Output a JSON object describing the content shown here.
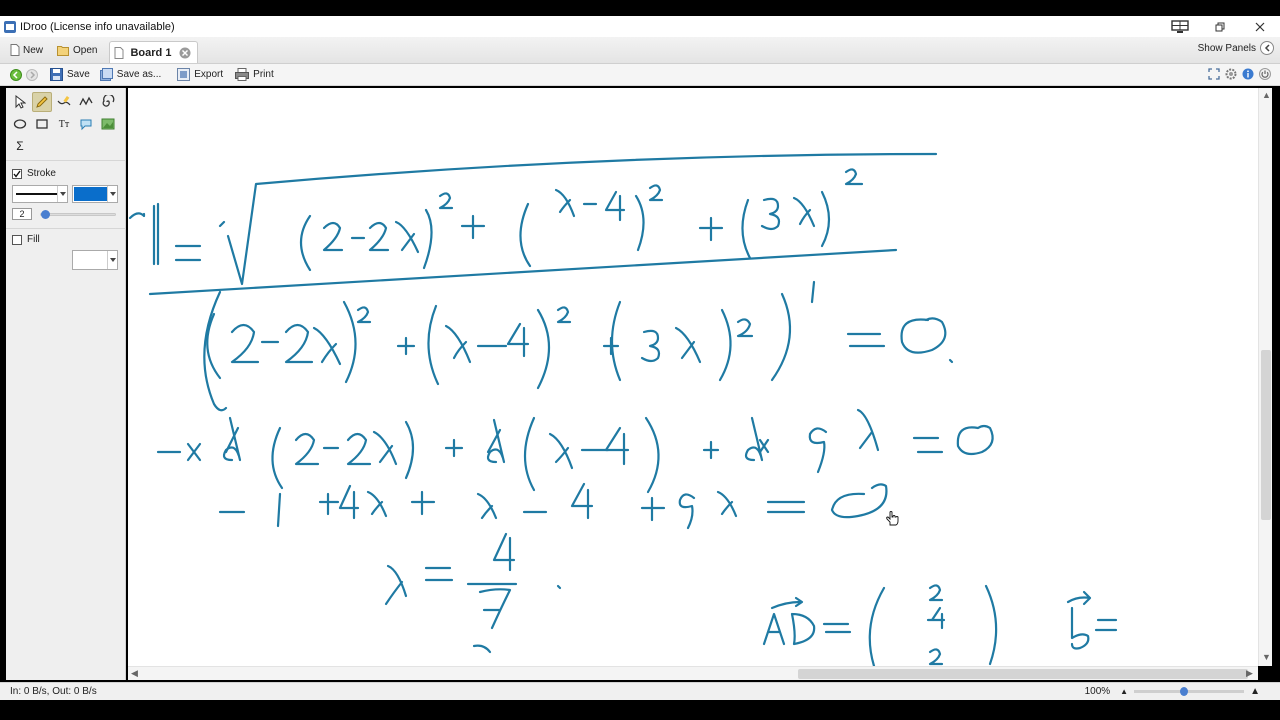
{
  "window": {
    "title": "IDroo (License info unavailable)"
  },
  "tabbar": {
    "new_label": "New",
    "open_label": "Open",
    "board_tab_label": "Board 1",
    "show_panels_label": "Show Panels"
  },
  "toolbar": {
    "save_label": "Save",
    "save_as_label": "Save as...",
    "export_label": "Export",
    "print_label": "Print"
  },
  "sidebar": {
    "tools": [
      "select-tool",
      "pencil-tool",
      "highlighter-tool",
      "polyline-tool",
      "spiral-tool",
      "ellipse-tool",
      "rectangle-tool",
      "text-tool",
      "callout-tool",
      "image-tool",
      "formula-tool"
    ],
    "active_tool": "pencil-tool",
    "text_tool_glyph": "Tт",
    "formula_glyph": "Σ",
    "stroke_label": "Stroke",
    "stroke_checked": true,
    "stroke_color": "#0a6ecb",
    "stroke_size": "2",
    "fill_label": "Fill",
    "fill_checked": false
  },
  "canvas": {
    "ink_color": "#1f7aa3",
    "handwriting": "‖r‖ = √((2−2λ)² + (λ−4)² + (3λ)²); ((2−2λ)² + (λ−4)² + (3λ)²)′ = 0; −2×2(2−2λ) + 2(λ−4) + 2×9λ = 0; −4 + 4λ + λ − 4 + 9λ = 0; λ = 4/7; AD = (2, −4, 2); b ="
  },
  "statusbar": {
    "network": "In: 0 B/s, Out: 0 B/s",
    "zoom_level": "100%",
    "zoom_fraction": 0.45
  }
}
